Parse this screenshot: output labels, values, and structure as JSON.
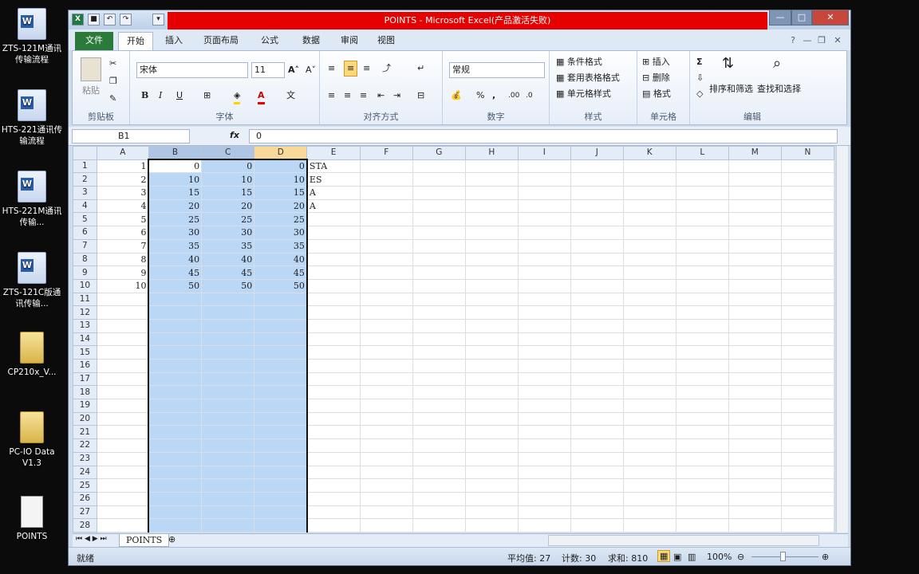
{
  "desktop": [
    {
      "label": "ZTS-121M通讯传输流程",
      "kind": "word"
    },
    {
      "label": "HTS-221通讯传输流程",
      "kind": "word"
    },
    {
      "label": "HTS-221M通讯传输...",
      "kind": "word"
    },
    {
      "label": "ZTS-121C版通讯传输...",
      "kind": "word"
    },
    {
      "label": "CP210x_V...",
      "kind": "folder"
    },
    {
      "label": "PC-IO Data V1.3",
      "kind": "folder"
    },
    {
      "label": "POINTS",
      "kind": "file"
    }
  ],
  "window": {
    "title": "POINTS - Microsoft Excel(产品激活失败)",
    "app_icon": "X"
  },
  "tabs": [
    "文件",
    "开始",
    "插入",
    "页面布局",
    "公式",
    "数据",
    "审阅",
    "视图"
  ],
  "ribbon": {
    "paste": "粘贴",
    "clipboard": "剪贴板",
    "font_name": "宋体",
    "font_size": "11",
    "font_group": "字体",
    "align_group": "对齐方式",
    "number_format": "常规",
    "number_group": "数字",
    "cond_format": "条件格式",
    "table_format": "套用表格格式",
    "cell_style": "单元格样式",
    "style_group": "样式",
    "insert": "插入",
    "delete": "删除",
    "format": "格式",
    "cells_group": "单元格",
    "sort_filter": "排序和筛选",
    "find_select": "查找和选择",
    "edit_group": "编辑",
    "bold": "B",
    "italic": "I",
    "underline": "U",
    "sigma": "Σ"
  },
  "formula_bar": {
    "name_box": "B1",
    "fx": "fx",
    "content": "0"
  },
  "columns": [
    "A",
    "B",
    "C",
    "D",
    "E",
    "F",
    "G",
    "H",
    "I",
    "J",
    "K",
    "L",
    "M",
    "N"
  ],
  "rows": [
    [
      "1",
      "0",
      "0",
      "0",
      "STA"
    ],
    [
      "2",
      "10",
      "10",
      "10",
      "ES"
    ],
    [
      "3",
      "15",
      "15",
      "15",
      "A"
    ],
    [
      "4",
      "20",
      "20",
      "20",
      "A"
    ],
    [
      "5",
      "25",
      "25",
      "25",
      ""
    ],
    [
      "6",
      "30",
      "30",
      "30",
      ""
    ],
    [
      "7",
      "35",
      "35",
      "35",
      ""
    ],
    [
      "8",
      "40",
      "40",
      "40",
      ""
    ],
    [
      "9",
      "45",
      "45",
      "45",
      ""
    ],
    [
      "10",
      "50",
      "50",
      "50",
      ""
    ]
  ],
  "row_count": 28,
  "sheet_tab": "POINTS",
  "status": {
    "ready": "就绪",
    "average": "平均值: 27",
    "count": "计数: 30",
    "sum": "求和: 810",
    "zoom": "100%"
  }
}
